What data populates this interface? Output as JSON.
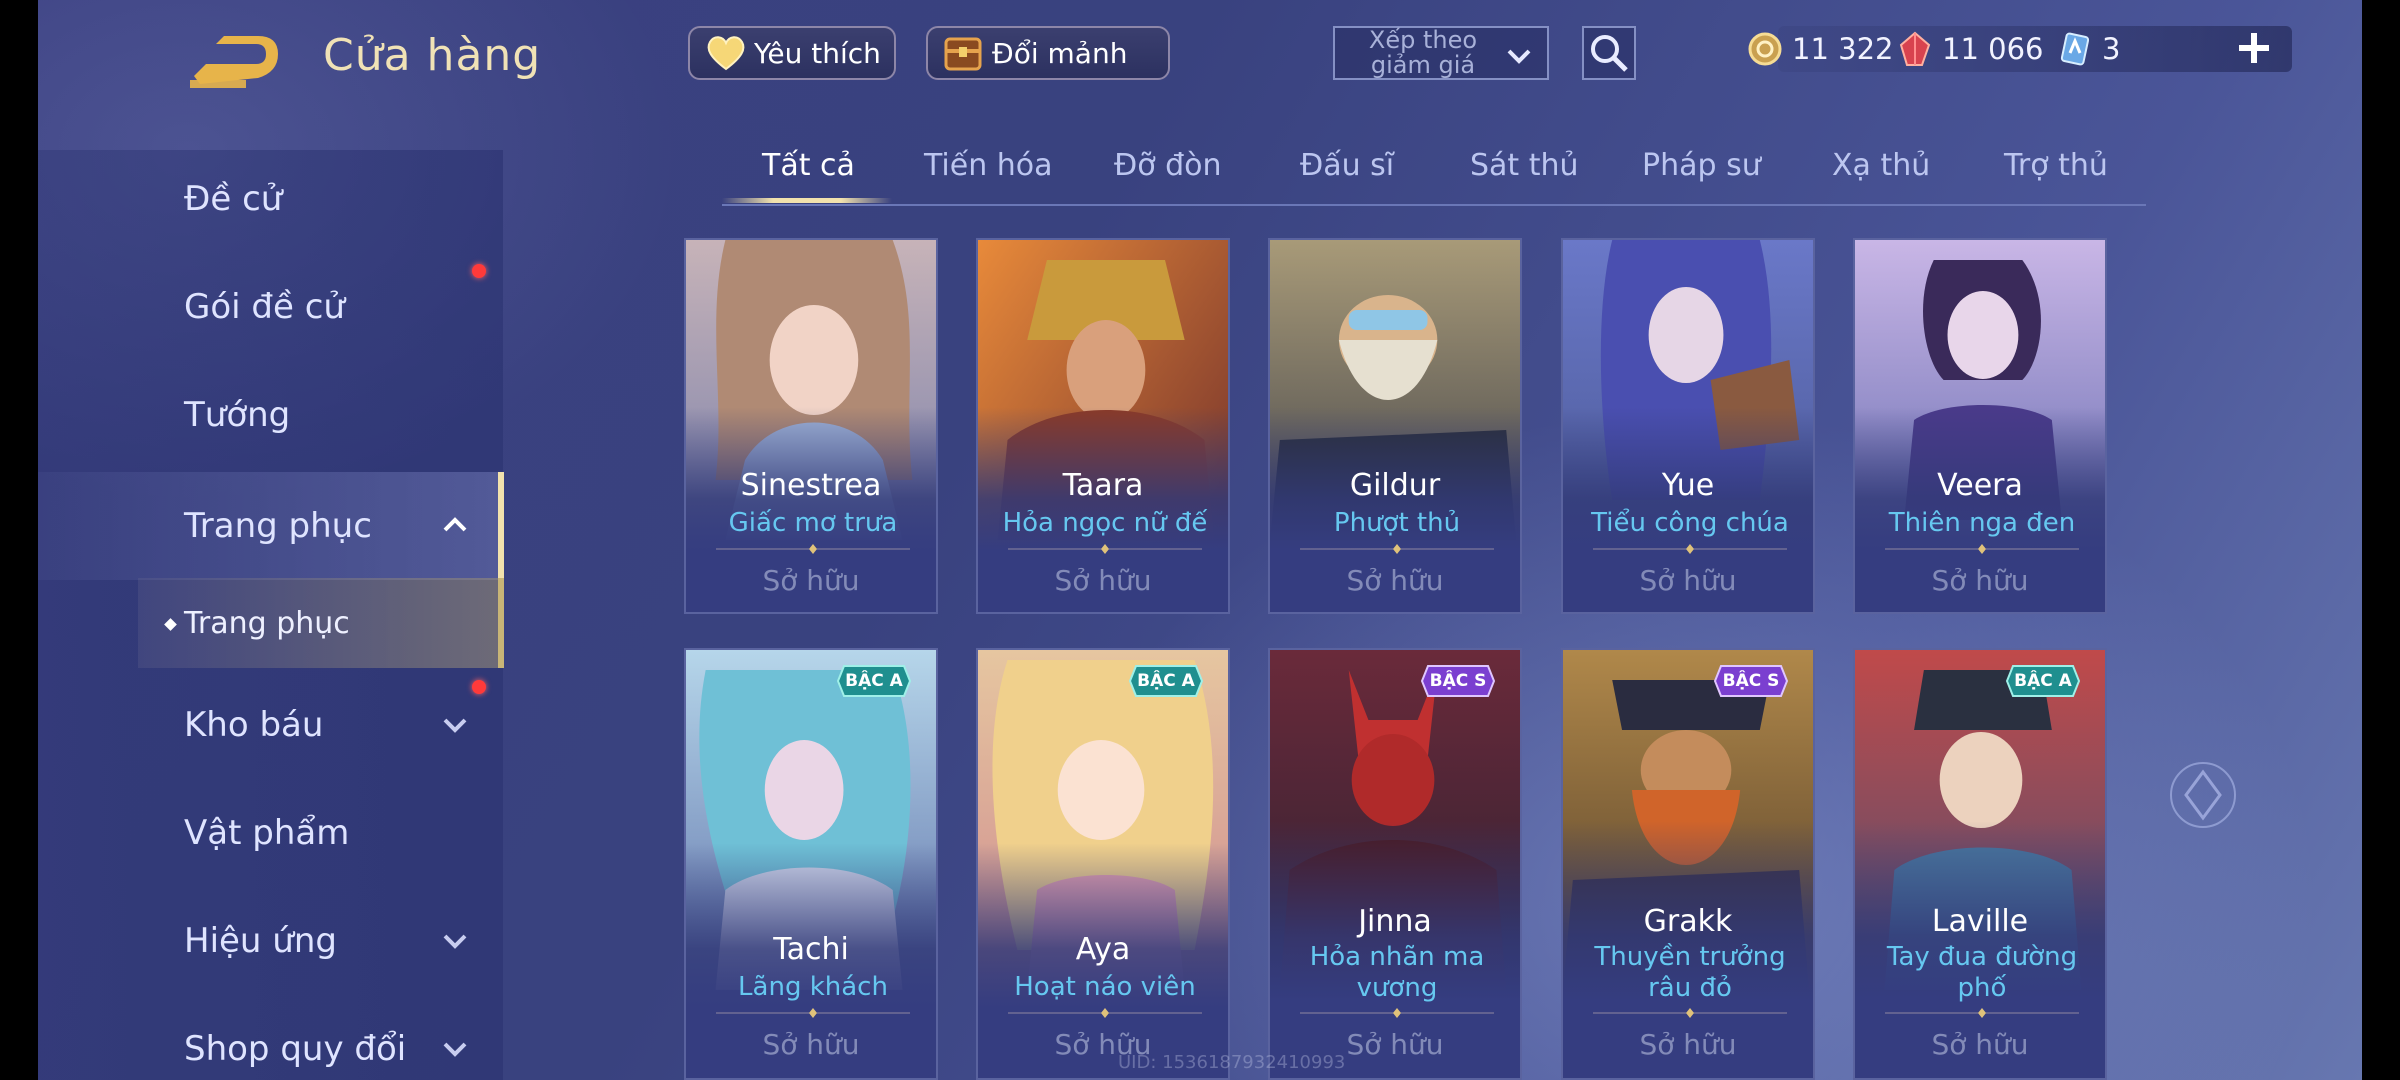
{
  "header": {
    "title": "Cửa hàng",
    "favorites_label": "Yêu thích",
    "exchange_label": "Đổi mảnh",
    "sort_label": "Xếp theo giảm giá",
    "currencies": [
      {
        "name": "gold-coin-icon",
        "value": "11 322"
      },
      {
        "name": "ruby-gem-icon",
        "value": "11 066"
      },
      {
        "name": "ticket-card-icon",
        "value": "3"
      }
    ]
  },
  "sidebar": {
    "items": [
      {
        "label": "Đề cử"
      },
      {
        "label": "Gói đề cử"
      },
      {
        "label": "Tướng"
      },
      {
        "label": "Trang phục"
      },
      {
        "label": "Kho báu"
      },
      {
        "label": "Vật phẩm"
      },
      {
        "label": "Hiệu ứng"
      },
      {
        "label": "Shop quy đổi"
      }
    ],
    "sub_item": "Trang phục"
  },
  "tabs": [
    "Tất cả",
    "Tiến hóa",
    "Đỡ đòn",
    "Đấu sĩ",
    "Sát thủ",
    "Pháp sư",
    "Xạ thủ",
    "Trợ thủ"
  ],
  "cards": [
    {
      "hero": "Sinestrea",
      "skin": "Giấc mơ trưa",
      "status": "Sở hữu",
      "badge": ""
    },
    {
      "hero": "Taara",
      "skin": "Hỏa ngọc nữ đế",
      "status": "Sở hữu",
      "badge": ""
    },
    {
      "hero": "Gildur",
      "skin": "Phượt thủ",
      "status": "Sở hữu",
      "badge": ""
    },
    {
      "hero": "Yue",
      "skin": "Tiểu công chúa",
      "status": "Sở hữu",
      "badge": ""
    },
    {
      "hero": "Veera",
      "skin": "Thiên nga đen",
      "status": "Sở hữu",
      "badge": ""
    },
    {
      "hero": "Tachi",
      "skin": "Lãng khách",
      "status": "Sở hữu",
      "badge": "BẬC A"
    },
    {
      "hero": "Aya",
      "skin": "Hoạt náo viên",
      "status": "Sở hữu",
      "badge": "BẬC A"
    },
    {
      "hero": "Jinna",
      "skin": "Hỏa nhãn ma vương",
      "status": "Sở hữu",
      "badge": "BẬC S"
    },
    {
      "hero": "Grakk",
      "skin": "Thuyền trưởng râu đỏ",
      "status": "Sở hữu",
      "badge": "BẬC S"
    },
    {
      "hero": "Laville",
      "skin": "Tay đua đường phố",
      "status": "Sở hữu",
      "badge": "BẬC A"
    }
  ],
  "footer": {
    "uid": "UID: 1536187932410993"
  },
  "colors": {
    "accent_gold": "#f2e2ad",
    "skin_name": "#66c8f0",
    "badge_a": "#1f8f8f",
    "badge_s": "#7b3fd0"
  }
}
